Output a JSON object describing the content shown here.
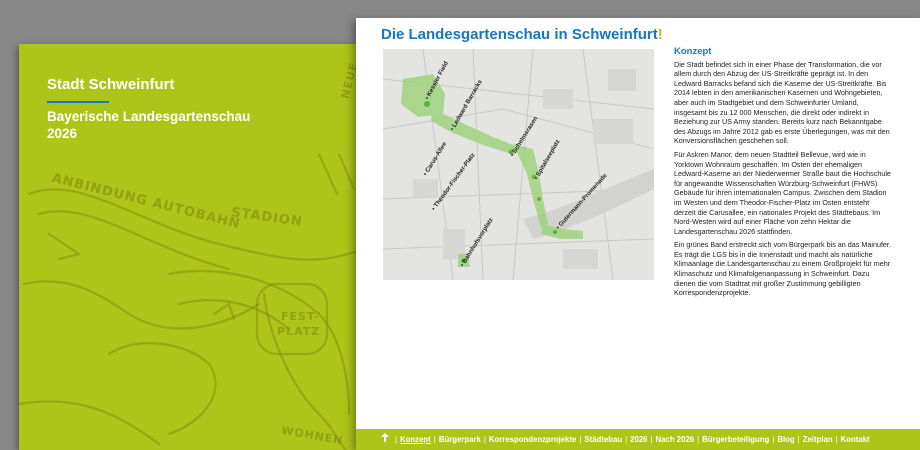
{
  "back": {
    "title": "Stadt Schweinfurt",
    "subtitle": "Bayerische Landesgartenschau 2026",
    "sketch_labels": [
      "ANBINDUNG AUTOBAHN",
      "STADION",
      "FEST-",
      "PLATZ",
      "NEUE",
      "WOHNEN"
    ]
  },
  "page": {
    "title": "Die Landesgartenschau in Schweinfurt",
    "title_excl": "!",
    "section": "Konzept",
    "paragraphs": [
      "Die Stadt befindet sich in einer Phase der Transformation, die vor allem durch den Abzug der US-Streitkräfte geprägt ist. In den Ledward Barracks befand sich die Kaserne der US-Streitkräfte. Bis 2014 lebten in den amerikanischen Kasernen und Wohngebieten, aber auch im Stadtgebiet und dem Schweinfurter Umland, insgesamt bis zu 12 000 Menschen, die direkt oder indirekt in Beziehung zur US Army standen. Bereits kurz nach Bekanntgabe des Abzugs im Jahre 2012 gab es erste Überlegungen, was mit den Konversionsflächen geschehen soll.",
      "Für Askren Manor, dem neuen Stadtteil Bellevue, wird wie in Yorktown Wohnraum geschaffen. Im Osten der ehemaligen Ledward-Kaserne an der Niederwermer Straße baut die Hochschule für angewandte Wissenschaften Würzburg-Schweinfurt (FHWS) Gebäude für ihren internationalen Campus. Zwischen dem Stadion im Westen und dem Theodor-Fischer-Platz im Osten entsteht derzeit die Carusallee, ein nationales Projekt des Städtebaus. Im Nord-Westen wird auf einer Fläche von zehn Hektar die Landesgartenschau 2026 stattfinden.",
      "Ein grünes Band erstreckt sich vom Bürgerpark bis an das Mainufer. Es trägt die LGS bis in die Innenstadt und macht als natürliche Klimaanlage die Landesgartenschau zu einem Großprojekt für mehr Klimaschutz und Klimafolgenanpassung in Schweinfurt. Dazu dienen die vom Stadtrat mit großer Zustimmung gebilligten Korrespondenzprojekte."
    ],
    "map_labels": [
      "Kessler Field",
      "Ledward Barracks",
      "Schelmsrasen",
      "Carus-Allee",
      "Spitalseeplatz",
      "Theodor-Fischer-Platz",
      "Gutermann-Promenade",
      "Bahnhofsvorplatz"
    ]
  },
  "footer": {
    "up_icon": "arrow-up-icon",
    "items": [
      "Konzept",
      "Bürgerpark",
      "Korrespondenzprojekte",
      "Städtebau",
      "2026",
      "Nach 2026",
      "Bürgerbeteiligung",
      "Blog",
      "Zeitplan",
      "Kontakt"
    ],
    "active": "Konzept"
  },
  "colors": {
    "accent_green": "#adc418",
    "accent_blue": "#1678c2",
    "background": "#878787"
  }
}
